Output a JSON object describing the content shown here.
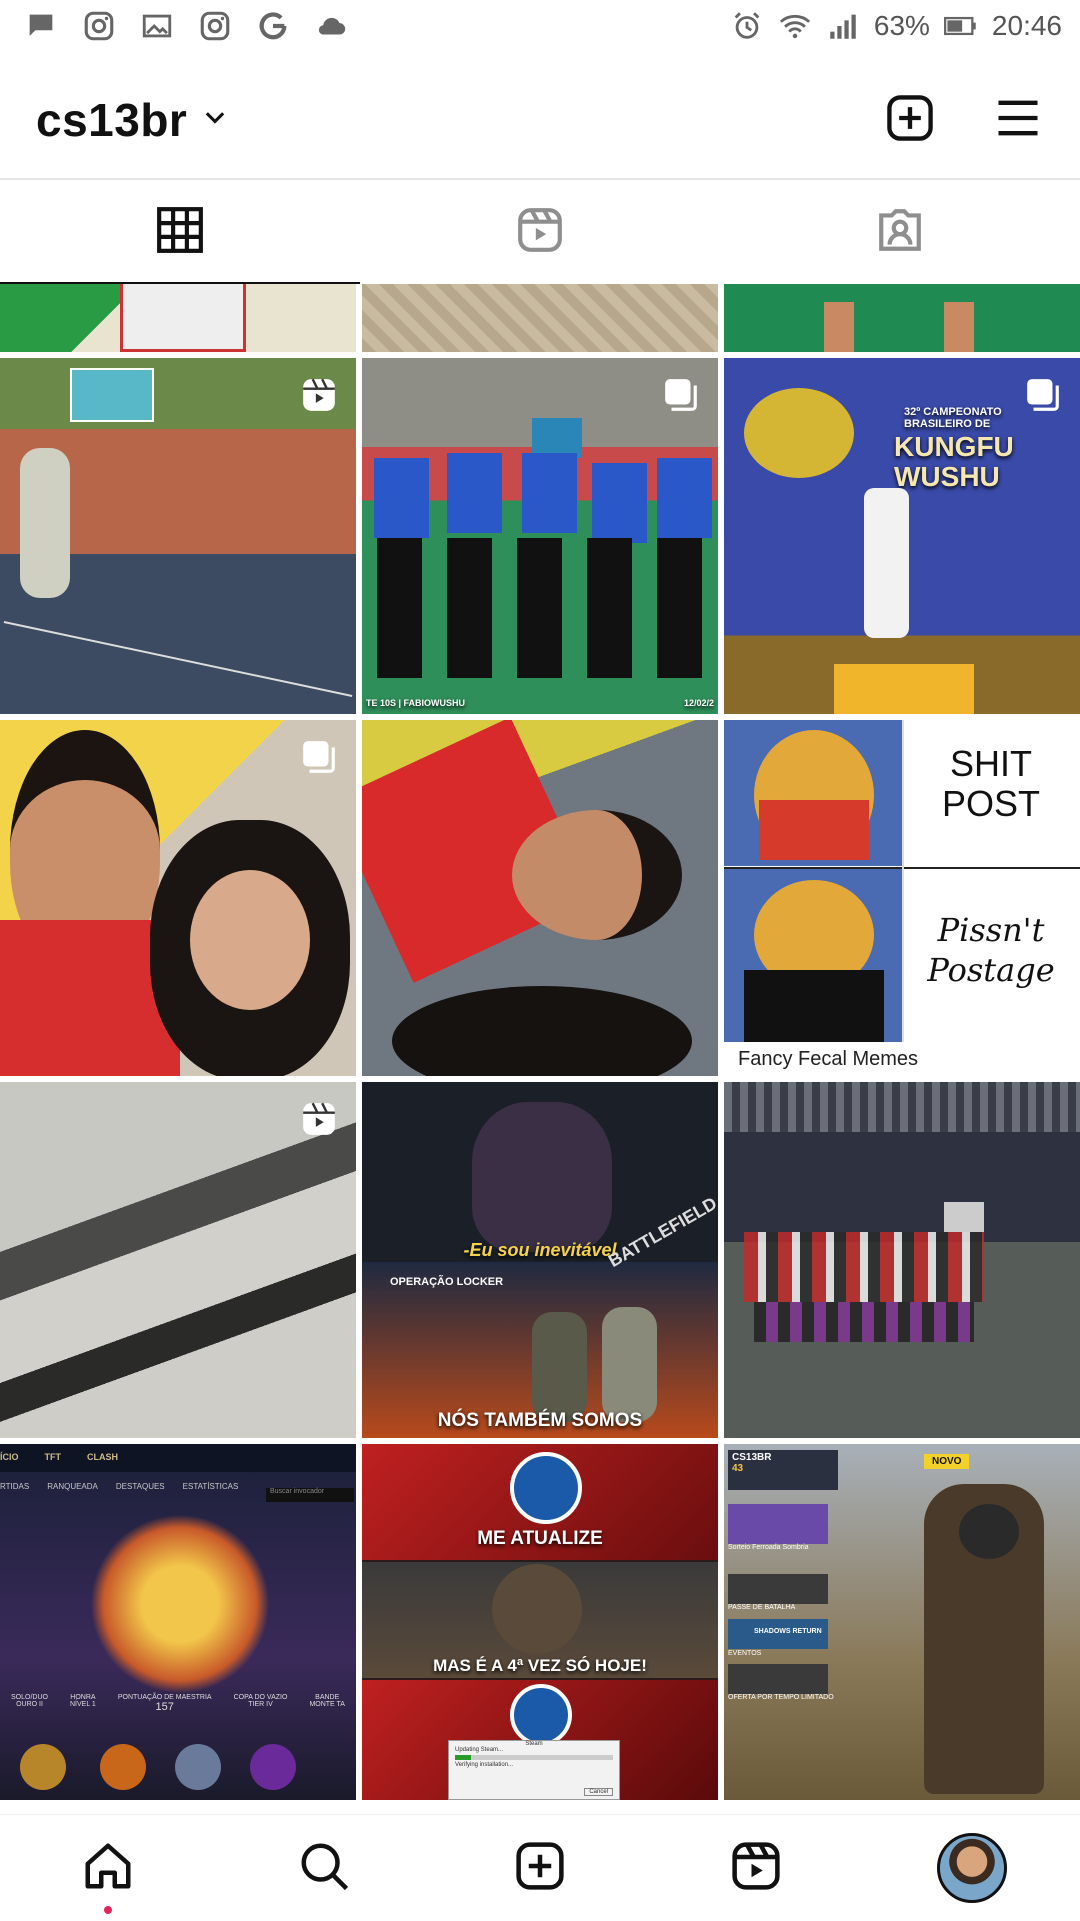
{
  "status_bar": {
    "battery": "63%",
    "time": "20:46",
    "left_icons": [
      "chat-icon",
      "instagram-icon",
      "gallery-icon",
      "instagram-icon",
      "google-icon",
      "cloud-icon"
    ],
    "right_icons": [
      "alarm-icon",
      "wifi-icon",
      "signal-icon",
      "battery-icon"
    ]
  },
  "header": {
    "username": "cs13br",
    "icons": [
      "chevron-down-icon",
      "new-post-icon",
      "menu-icon"
    ]
  },
  "tabs": [
    {
      "name": "posts-grid",
      "icon": "grid-icon",
      "active": true
    },
    {
      "name": "reels",
      "icon": "reels-icon",
      "active": false
    },
    {
      "name": "tagged",
      "icon": "tagged-icon",
      "active": false
    }
  ],
  "posts": {
    "shit_post": "SHIT\nPOST",
    "pissnt_postage": "Pissn't\nPostage",
    "fancy_fecal": "Fancy Fecal Memes",
    "kungfu_banner": "32º CAMPEONATO BRASILEIRO DE",
    "kungfu_title": "KUNGFU WUSHU",
    "thanos_caption": "-Eu sou inevitável",
    "battlefield": "BATTLEFIELD",
    "operacao": "OPERAÇÃO LOCKER",
    "nos_tambem": "NÓS TAMBÉM SOMOS",
    "me_atualize": "ME ATUALIZE",
    "mas_e": "MAS É A 4ª VEZ SÓ HOJE!",
    "lol_nav": [
      "ÍCIO",
      "TFT",
      "CLASH"
    ],
    "lol_sub": [
      "RTIDAS",
      "RANQUEADA",
      "DESTAQUES",
      "ESTATÍSTICAS"
    ],
    "lol_search": "Buscar invocador",
    "lol_stats": [
      "SOLO/DUO",
      "HONRA",
      "PONTUAÇÃO DE MAESTRIA",
      "COPA DO VAZIO",
      "BANDE"
    ],
    "lol_stat_values": [
      "OURO II",
      "NÍVEL 1",
      "157",
      "TIER IV",
      "MONTE TA"
    ],
    "cod_name": "CS13BR",
    "cod_level": "43",
    "cod_menu": [
      "Sorteio Ferroada Sombria",
      "PASSE DE BATALHA",
      "SHADOWS RETURN",
      "EVENTOS",
      "OFERTA POR TEMPO LIMITADO"
    ],
    "cod_new": "NOVO",
    "steam_dialog": "Steam",
    "steam_updating": "Updating Steam...",
    "steam_verify": "Verifying installation...",
    "steam_cancel": "Cancel",
    "frame_left": "TE 10S | FABIOWUSHU",
    "frame_right": "12/02/2"
  },
  "bottom_nav": [
    {
      "name": "home",
      "icon": "home-icon"
    },
    {
      "name": "search",
      "icon": "search-icon"
    },
    {
      "name": "create",
      "icon": "new-post-icon"
    },
    {
      "name": "reels",
      "icon": "reels-icon"
    },
    {
      "name": "profile",
      "icon": "avatar"
    }
  ]
}
